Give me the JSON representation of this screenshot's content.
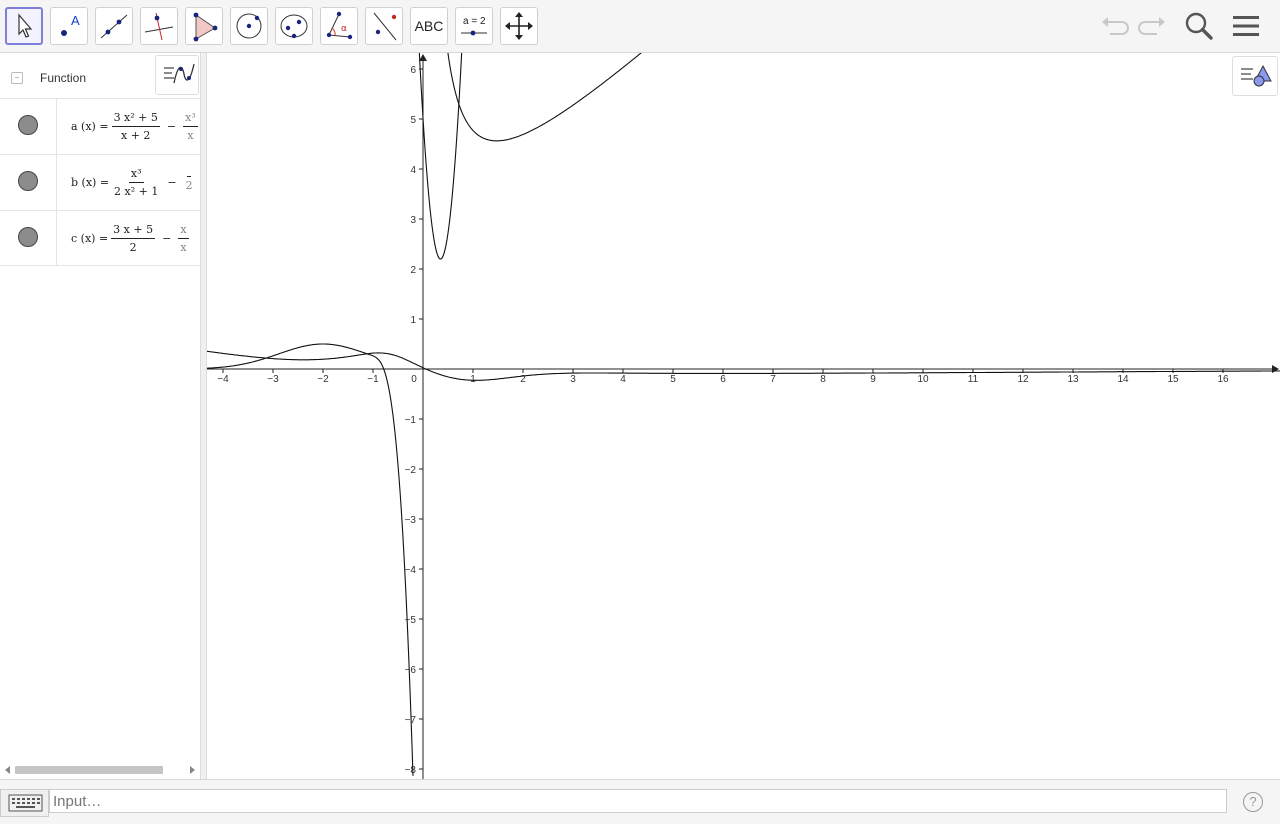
{
  "toolbar": {
    "tools": [
      {
        "name": "move-tool",
        "icon": "cursor-arrow-icon",
        "active": true
      },
      {
        "name": "point-tool",
        "icon": "point-icon"
      },
      {
        "name": "line-tool",
        "icon": "line-through-points-icon"
      },
      {
        "name": "perpendicular-line-tool",
        "icon": "perpendicular-line-icon"
      },
      {
        "name": "polygon-tool",
        "icon": "polygon-icon"
      },
      {
        "name": "circle-tool",
        "icon": "circle-center-point-icon"
      },
      {
        "name": "conic-tool",
        "icon": "ellipse-icon"
      },
      {
        "name": "angle-tool",
        "icon": "angle-icon"
      },
      {
        "name": "reflect-tool",
        "icon": "reflect-about-line-icon"
      },
      {
        "name": "text-tool",
        "label": "ABC"
      },
      {
        "name": "slider-tool",
        "label": "a = 2"
      },
      {
        "name": "move-graphics-tool",
        "icon": "move-arrows-icon"
      }
    ],
    "undo_icon": "undo-icon",
    "redo_icon": "redo-icon",
    "search_icon": "search-icon",
    "menu_icon": "hamburger-menu-icon"
  },
  "algebra": {
    "title": "Function",
    "items": [
      {
        "name": "a",
        "lhs": "a (x) =",
        "num": "3 x² + 5",
        "den": "x + 2",
        "op": "−",
        "rest_num": "x³",
        "rest_den": "x"
      },
      {
        "name": "b",
        "lhs": "b (x) =",
        "num": "x³",
        "den": "2 x² + 1",
        "op": "−",
        "rest_num": "",
        "rest_den": "2"
      },
      {
        "name": "c",
        "lhs": "c (x) =",
        "num": "3 x + 5",
        "den": "2",
        "op": "−",
        "rest_num": "x",
        "rest_den": "x"
      }
    ]
  },
  "graphics": {
    "x_ticks": [
      "−4",
      "−3",
      "−2",
      "−1",
      "0",
      "1",
      "2",
      "3",
      "4",
      "5",
      "6",
      "7",
      "8",
      "9",
      "10",
      "11",
      "12",
      "13",
      "14",
      "15",
      "16"
    ],
    "y_ticks_pos": [
      "1",
      "2",
      "3",
      "4",
      "5",
      "6"
    ],
    "y_ticks_neg": [
      "−1",
      "−2",
      "−3",
      "−4",
      "−5",
      "−6",
      "−7",
      "−8"
    ]
  },
  "input": {
    "placeholder": "Input…",
    "help": "?"
  }
}
